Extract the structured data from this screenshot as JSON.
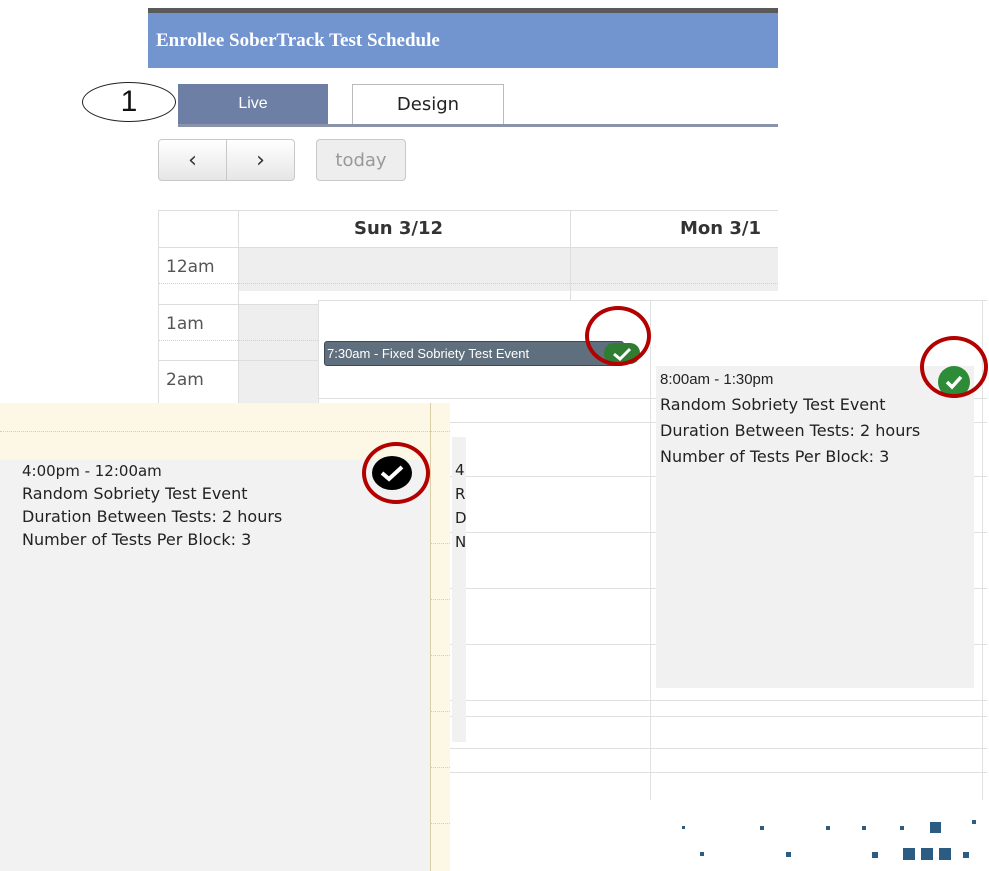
{
  "header": {
    "title": "Enrollee SoberTrack Test Schedule",
    "bar_color": "#7395cf"
  },
  "step_marker": {
    "label": "1"
  },
  "tabs": [
    {
      "label": "Live",
      "active": true
    },
    {
      "label": "Design",
      "active": false
    }
  ],
  "toolbar": {
    "prev_icon": "chevron-left-icon",
    "prev_glyph": "‹",
    "next_icon": "chevron-right-icon",
    "next_glyph": "›",
    "today_label": "today"
  },
  "calendar": {
    "days": [
      "Sun 3/12",
      "Mon 3/1"
    ],
    "times": [
      "12am",
      "1am",
      "2am"
    ]
  },
  "events": {
    "fixed": {
      "label": "7:30am - Fixed Sobriety Test Event",
      "status_icon": "check-circle-icon",
      "color": "#5f6f7d"
    },
    "random_right": {
      "time": "8:00am - 1:30pm",
      "title": "Random Sobriety Test Event",
      "duration": "Duration Between Tests: 2 hours",
      "count": "Number of Tests Per Block: 3",
      "status_icon": "check-circle-icon",
      "status_color": "#2e8b37"
    },
    "random_left": {
      "time": "4:00pm - 12:00am",
      "title": "Random Sobriety Test Event",
      "duration": "Duration Between Tests: 2 hours",
      "count": "Number of Tests Per Block: 3",
      "status_icon": "check-circle-icon",
      "status_color": "#000000"
    },
    "partial": {
      "letters": [
        "4",
        "R",
        "D",
        "N"
      ]
    }
  },
  "annotations": {
    "ring_color": "#b30000"
  }
}
